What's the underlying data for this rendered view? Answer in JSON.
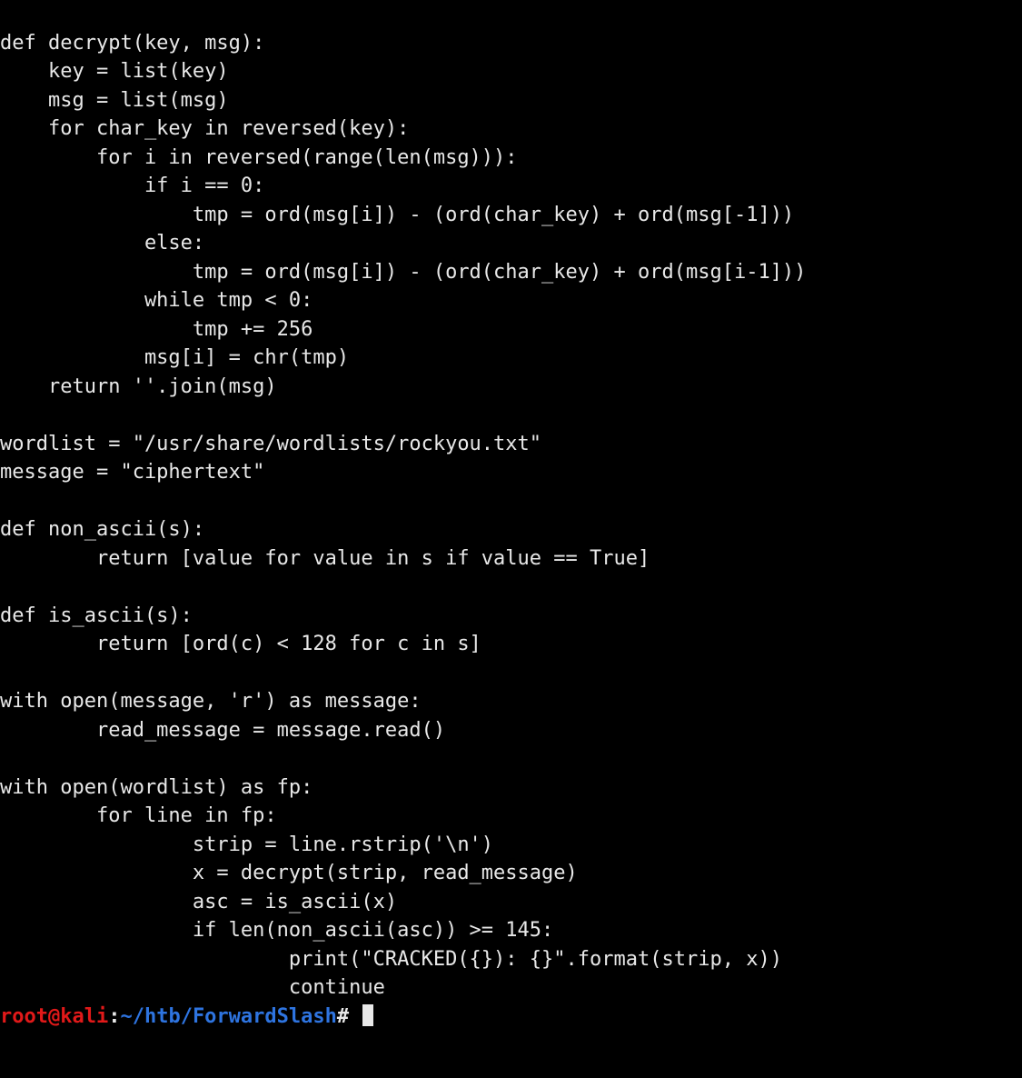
{
  "code": {
    "l01": "def decrypt(key, msg):",
    "l02": "    key = list(key)",
    "l03": "    msg = list(msg)",
    "l04": "    for char_key in reversed(key):",
    "l05": "        for i in reversed(range(len(msg))):",
    "l06": "            if i == 0:",
    "l07": "                tmp = ord(msg[i]) - (ord(char_key) + ord(msg[-1]))",
    "l08": "            else:",
    "l09": "                tmp = ord(msg[i]) - (ord(char_key) + ord(msg[i-1]))",
    "l10": "            while tmp < 0:",
    "l11": "                tmp += 256",
    "l12": "            msg[i] = chr(tmp)",
    "l13": "    return ''.join(msg)",
    "l14": "",
    "l15": "wordlist = \"/usr/share/wordlists/rockyou.txt\"",
    "l16": "message = \"ciphertext\"",
    "l17": "",
    "l18": "def non_ascii(s):",
    "l19": "        return [value for value in s if value == True]",
    "l20": "",
    "l21": "def is_ascii(s):",
    "l22": "        return [ord(c) < 128 for c in s]",
    "l23": "",
    "l24": "with open(message, 'r') as message:",
    "l25": "        read_message = message.read()",
    "l26": "",
    "l27": "with open(wordlist) as fp:",
    "l28": "        for line in fp:",
    "l29": "                strip = line.rstrip('\\n')",
    "l30": "                x = decrypt(strip, read_message)",
    "l31": "                asc = is_ascii(x)",
    "l32": "                if len(non_ascii(asc)) >= 145:",
    "l33": "                        print(\"CRACKED({}): {}\".format(strip, x))",
    "l34": "                        continue"
  },
  "prompt": {
    "user": "root@kali",
    "sep1": ":",
    "path": "~/htb/ForwardSlash",
    "sep2": "#"
  }
}
